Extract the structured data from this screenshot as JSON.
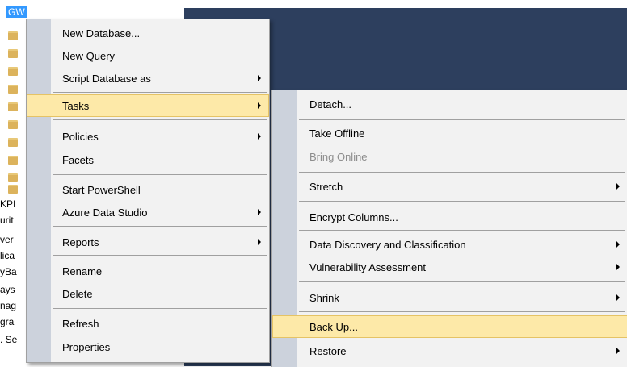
{
  "explorer": {
    "server_label": "GW",
    "fragments": [
      "KPI",
      "urit",
      "ver",
      "lica",
      "yBa",
      "ays",
      "nag",
      "gra",
      ". Se"
    ]
  },
  "context_menu": {
    "items": [
      {
        "label": "New Database..."
      },
      {
        "label": "New Query"
      },
      {
        "label": "Script Database as",
        "submenu": true
      },
      {
        "label": "Tasks",
        "submenu": true,
        "highlighted": true
      },
      {
        "label": "Policies",
        "submenu": true
      },
      {
        "label": "Facets"
      },
      {
        "label": "Start PowerShell"
      },
      {
        "label": "Azure Data Studio",
        "submenu": true
      },
      {
        "label": "Reports",
        "submenu": true
      },
      {
        "label": "Rename"
      },
      {
        "label": "Delete"
      },
      {
        "label": "Refresh"
      },
      {
        "label": "Properties"
      }
    ]
  },
  "tasks_submenu": {
    "items": [
      {
        "label": "Detach..."
      },
      {
        "label": "Take Offline"
      },
      {
        "label": "Bring Online",
        "disabled": true
      },
      {
        "label": "Stretch",
        "submenu": true
      },
      {
        "label": "Encrypt Columns..."
      },
      {
        "label": "Data Discovery and Classification",
        "submenu": true
      },
      {
        "label": "Vulnerability Assessment",
        "submenu": true
      },
      {
        "label": "Shrink",
        "submenu": true
      },
      {
        "label": "Back Up...",
        "highlighted": true
      },
      {
        "label": "Restore",
        "submenu": true
      }
    ]
  },
  "colors": {
    "menu_background": "#f2f2f2",
    "gutter": "#ccd2dc",
    "highlight": "#fde9a8",
    "canvas": "#2d3f5e",
    "selection": "#3399ff"
  }
}
